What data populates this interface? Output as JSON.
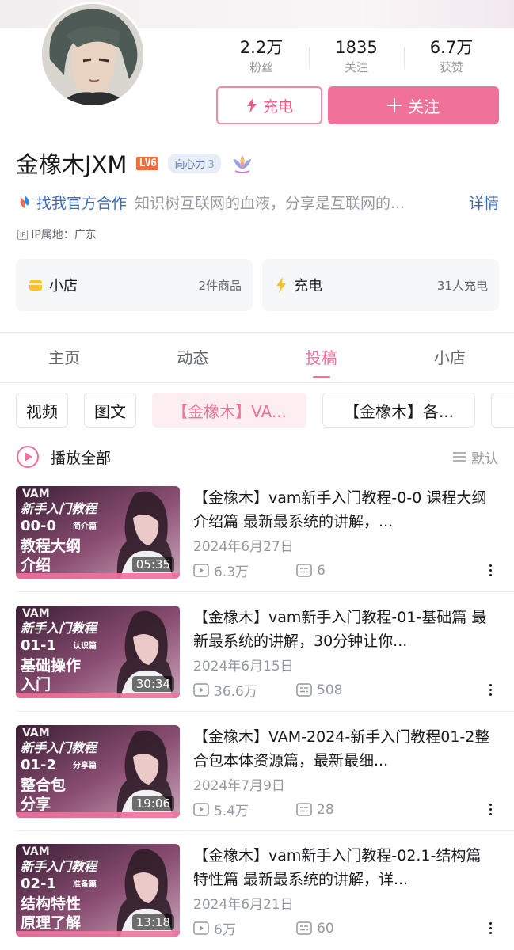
{
  "profile": {
    "name": "金橡木JXM",
    "level": "LV6",
    "heart_label": "向心力",
    "heart_value": "3",
    "coop_label": "找我官方合作",
    "sign": "知识树互联网的血液，分享是互联网的...",
    "detail_label": "详情",
    "ip": "IP属地：广东"
  },
  "stats": [
    {
      "num": "2.2万",
      "label": "粉丝"
    },
    {
      "num": "1835",
      "label": "关注"
    },
    {
      "num": "6.7万",
      "label": "获赞"
    }
  ],
  "buttons": {
    "charge": "充电",
    "follow": "关注"
  },
  "cards": {
    "shop": {
      "title": "小店",
      "meta": "2件商品"
    },
    "charge": {
      "title": "充电",
      "meta": "31人充电"
    }
  },
  "tabs": [
    "主页",
    "动态",
    "投稿",
    "小店"
  ],
  "chips": [
    "视频",
    "图文",
    "【金橡木】VA...",
    "【金橡木】各..."
  ],
  "play_all": "播放全部",
  "sort": "默认",
  "videos": [
    {
      "title": "【金橡木】vam新手入门教程-0-0 课程大纲介绍篇 最新最系统的讲解，...",
      "date": "2024年6月27日",
      "views": "6.3万",
      "comments": "6",
      "duration": "05:35",
      "thumb_lines": [
        "VAM",
        "新手入门教程",
        "00-0",
        "简介篇",
        "教程大纲",
        "介绍"
      ]
    },
    {
      "title": "【金橡木】vam新手入门教程-01-基础篇 最新最系统的讲解，30分钟让你...",
      "date": "2024年6月15日",
      "views": "36.6万",
      "comments": "508",
      "duration": "30:34",
      "thumb_lines": [
        "VAM",
        "新手入门教程",
        "01-1",
        "认识篇",
        "基础操作",
        "入门"
      ]
    },
    {
      "title": "【金橡木】VAM-2024-新手入门教程01-2整合包本体资源篇，最新最细...",
      "date": "2024年7月9日",
      "views": "5.4万",
      "comments": "28",
      "duration": "19:06",
      "thumb_lines": [
        "VAM",
        "新手入门教程",
        "01-2",
        "分享篇",
        "整合包",
        "分享"
      ]
    },
    {
      "title": "【金橡木】vam新手入门教程-02.1-结构篇 特性篇 最新最系统的讲解，详...",
      "date": "2024年6月21日",
      "views": "6万",
      "comments": "60",
      "duration": "13:18",
      "thumb_lines": [
        "VAM",
        "新手入门教程",
        "02-1",
        "准备篇",
        "结构特性",
        "原理了解"
      ]
    }
  ],
  "colors": {
    "accent": "#f07199",
    "link": "#3d6bb0",
    "muted": "#9499a0"
  }
}
